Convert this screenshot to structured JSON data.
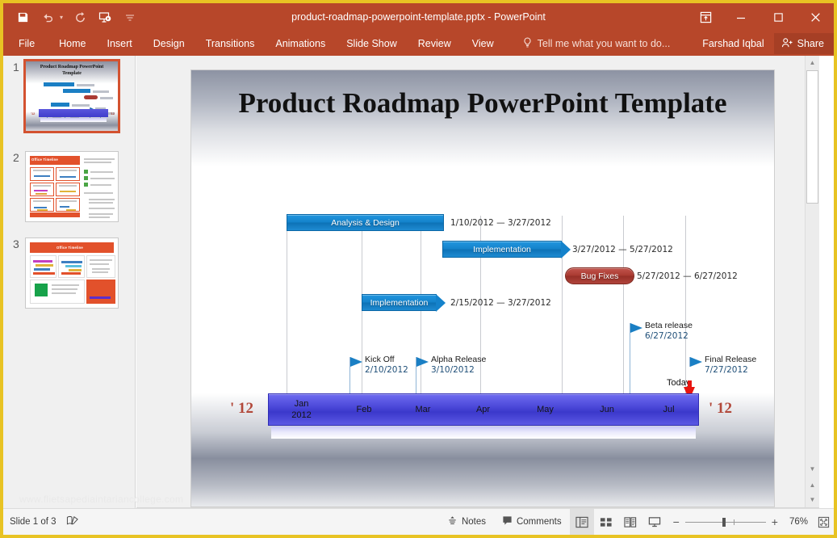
{
  "window": {
    "title": "product-roadmap-powerpoint-template.pptx - PowerPoint",
    "accent_color": "#b7472a",
    "border_color": "#e8c323"
  },
  "quick_access": {
    "items": [
      {
        "name": "save-icon",
        "label": "Save"
      },
      {
        "name": "undo-icon",
        "label": "Undo"
      },
      {
        "name": "redo-icon",
        "label": "Redo"
      },
      {
        "name": "start-presentation-icon",
        "label": "Start From Beginning"
      },
      {
        "name": "customize-quick-access-icon",
        "label": "Customize Quick Access Toolbar"
      }
    ]
  },
  "window_controls": {
    "ribbon_display_options": "Ribbon Display Options",
    "minimize": "Minimize",
    "restore": "Restore Down",
    "close": "Close"
  },
  "ribbon": {
    "tabs": [
      {
        "label": "File"
      },
      {
        "label": "Home"
      },
      {
        "label": "Insert"
      },
      {
        "label": "Design"
      },
      {
        "label": "Transitions"
      },
      {
        "label": "Animations"
      },
      {
        "label": "Slide Show"
      },
      {
        "label": "Review"
      },
      {
        "label": "View"
      }
    ],
    "tell_me": "Tell me what you want to do...",
    "user_name": "Farshad Iqbal",
    "share_label": "Share"
  },
  "thumbnails": [
    {
      "number": "1",
      "selected": true,
      "title": "Product Roadmap PowerPoint Template"
    },
    {
      "number": "2",
      "selected": false,
      "title": "Office Timeline"
    },
    {
      "number": "3",
      "selected": false,
      "title": "Office Timeline"
    }
  ],
  "slide": {
    "title": "Product Roadmap PowerPoint Template",
    "watermark": "www.flietsapediaintariancollege.com"
  },
  "chart_data": {
    "type": "bar",
    "title": "Product Roadmap PowerPoint Template",
    "xlabel": "",
    "ylabel": "",
    "timeline": {
      "year_left": "' 12",
      "year_right": "' 12",
      "months": [
        "Jan\n2012",
        "Feb",
        "Mar",
        "Apr",
        "May",
        "Jun",
        "Jul"
      ],
      "month_labels": [
        {
          "line1": "Jan",
          "line2": "2012"
        },
        {
          "line1": "Feb",
          "line2": ""
        },
        {
          "line1": "Mar",
          "line2": ""
        },
        {
          "line1": "Apr",
          "line2": ""
        },
        {
          "line1": "May",
          "line2": ""
        },
        {
          "line1": "Jun",
          "line2": ""
        },
        {
          "line1": "Jul",
          "line2": ""
        }
      ],
      "today_label": "Today",
      "today_position_pct": 89
    },
    "tasks": [
      {
        "label": "Analysis & Design",
        "date_range": "1/10/2012 — 3/27/2012",
        "start": "1/10/2012",
        "end": "3/27/2012",
        "color": "#1482cb",
        "shape": "rect",
        "row": 0
      },
      {
        "label": "Implementation",
        "date_range": "3/27/2012 — 5/27/2012",
        "start": "3/27/2012",
        "end": "5/27/2012",
        "color": "#1482cb",
        "shape": "arrow",
        "row": 1
      },
      {
        "label": "Bug Fixes",
        "date_range": "5/27/2012 — 6/27/2012",
        "start": "5/27/2012",
        "end": "6/27/2012",
        "color": "#a93a31",
        "shape": "pill",
        "row": 2
      },
      {
        "label": "Implementation",
        "date_range": "2/15/2012 — 3/27/2012",
        "start": "2/15/2012",
        "end": "3/27/2012",
        "color": "#1482cb",
        "shape": "arrow",
        "row": 3
      }
    ],
    "milestones": [
      {
        "name": "Kick Off",
        "date": "2/10/2012"
      },
      {
        "name": "Alpha Release",
        "date": "3/10/2012"
      },
      {
        "name": "Beta release",
        "date": "6/27/2012"
      },
      {
        "name": "Final Release",
        "date": "7/27/2012"
      }
    ]
  },
  "status_bar": {
    "slide_counter": "Slide 1 of 3",
    "accessibility_icon": "accessibility-checker-icon",
    "notes_label": "Notes",
    "comments_label": "Comments",
    "views": [
      {
        "name": "normal-view",
        "label": "Normal",
        "active": true
      },
      {
        "name": "slide-sorter-view",
        "label": "Slide Sorter",
        "active": false
      },
      {
        "name": "reading-view",
        "label": "Reading View",
        "active": false
      },
      {
        "name": "slide-show-view",
        "label": "Slide Show",
        "active": false
      }
    ],
    "zoom_out": "−",
    "zoom_in": "+",
    "zoom_level": "76%",
    "fit_slide": "Fit slide to current window"
  }
}
